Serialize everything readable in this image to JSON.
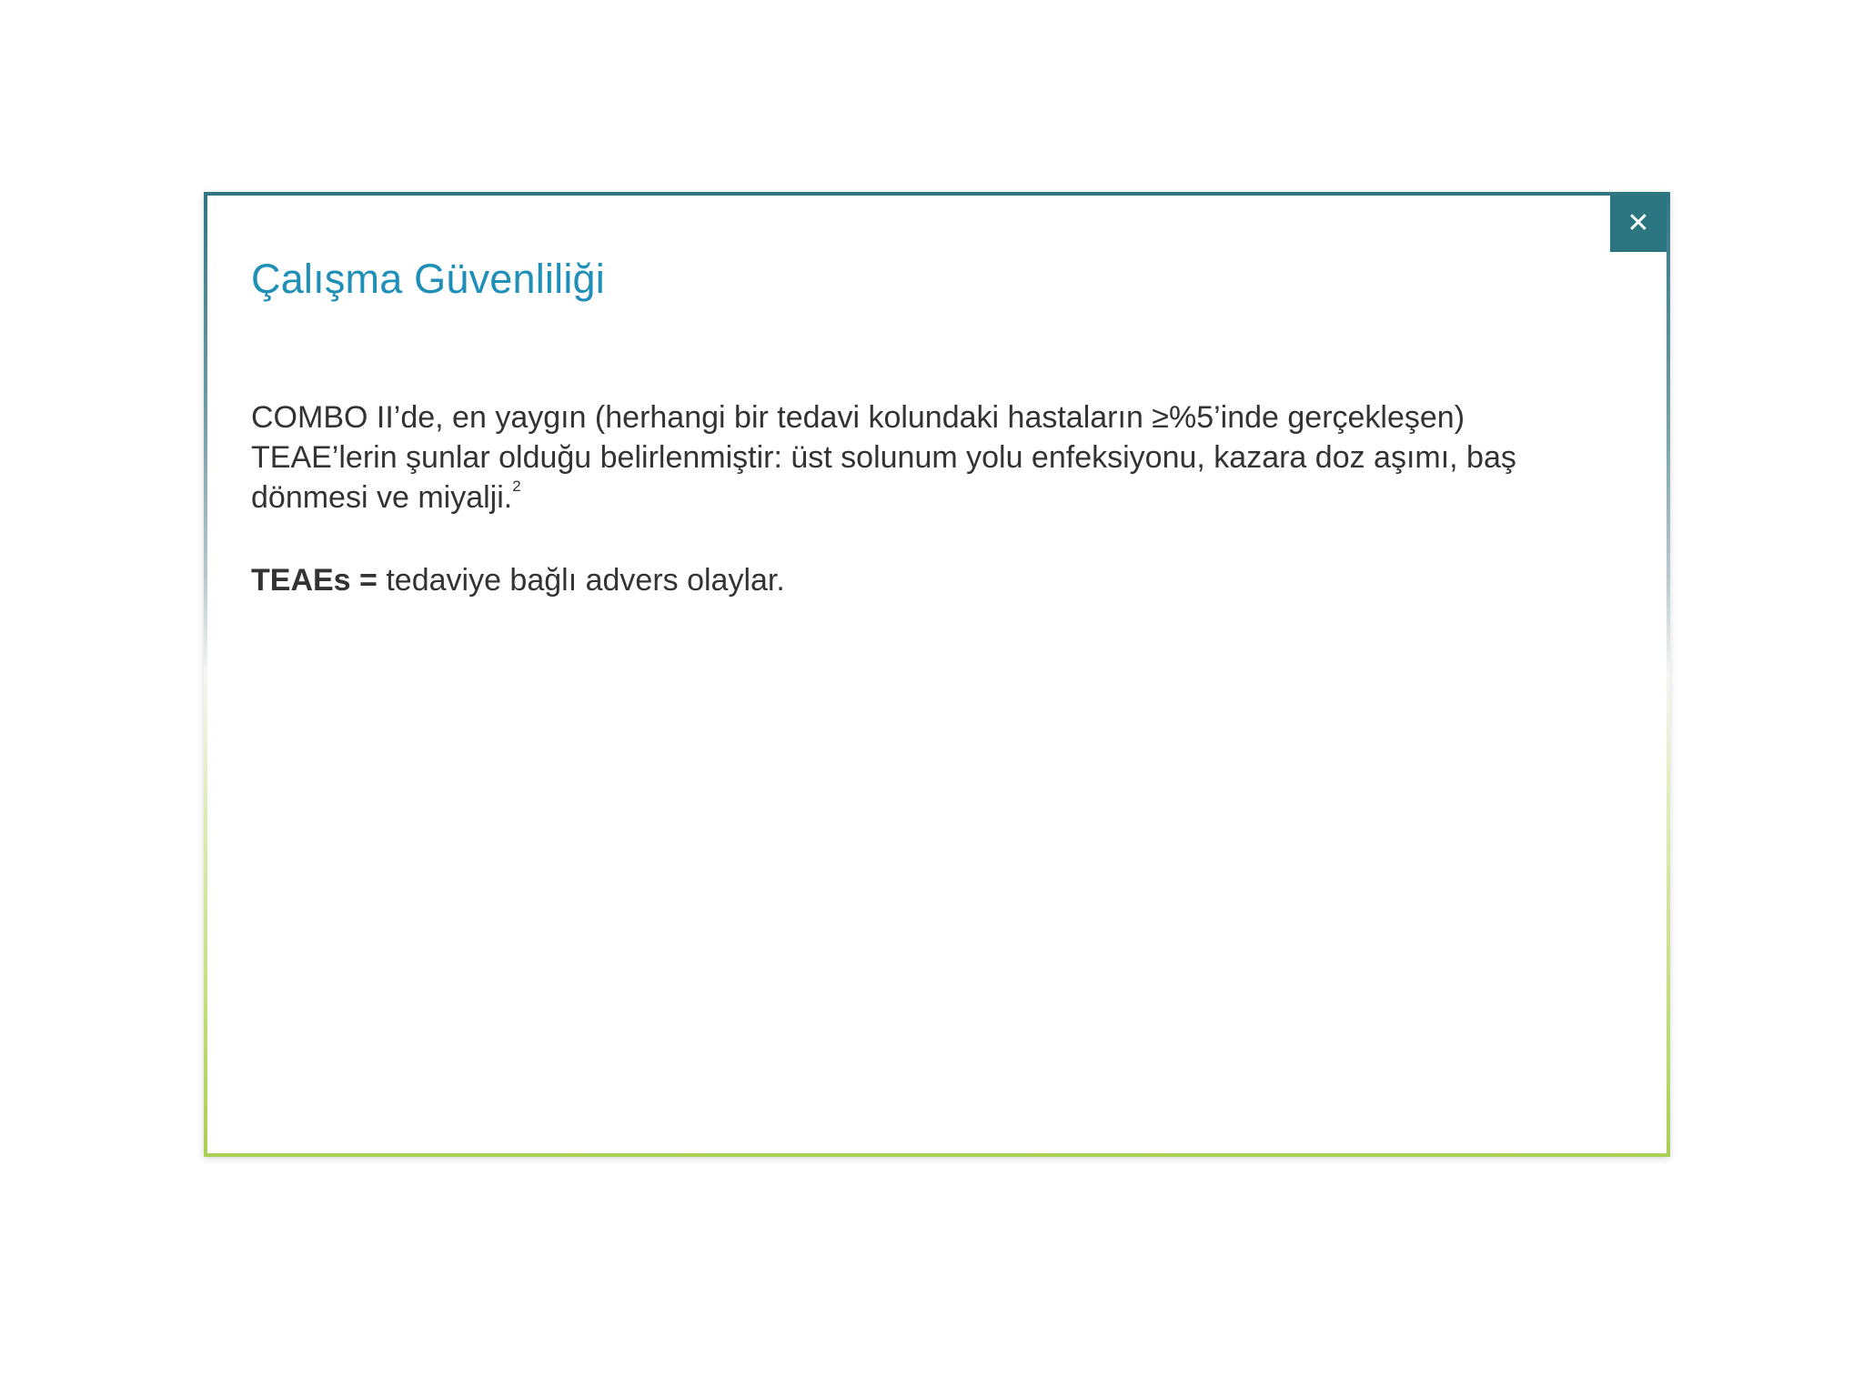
{
  "modal": {
    "title": "Çalışma Güvenliliği",
    "close_label": "✕",
    "paragraph": "COMBO II’de, en yaygın (herhangi bir tedavi kolundaki hastaların ≥%5’inde gerçekleşen) TEAE’lerin şunlar olduğu belirlenmiştir: üst solunum yolu enfeksiyonu, kazara doz aşımı, baş dönmesi ve miyalji.",
    "reference_mark": "2",
    "abbreviation": {
      "term": "TEAEs =",
      "definition": " tedaviye bağlı advers olaylar."
    }
  },
  "colors": {
    "accent": "#1f8fb8",
    "close_bg": "#2b7580",
    "border_top": "#2f7783",
    "border_bottom": "#a9cf54",
    "text": "#333333"
  },
  "icons": {
    "close": "close-icon"
  }
}
